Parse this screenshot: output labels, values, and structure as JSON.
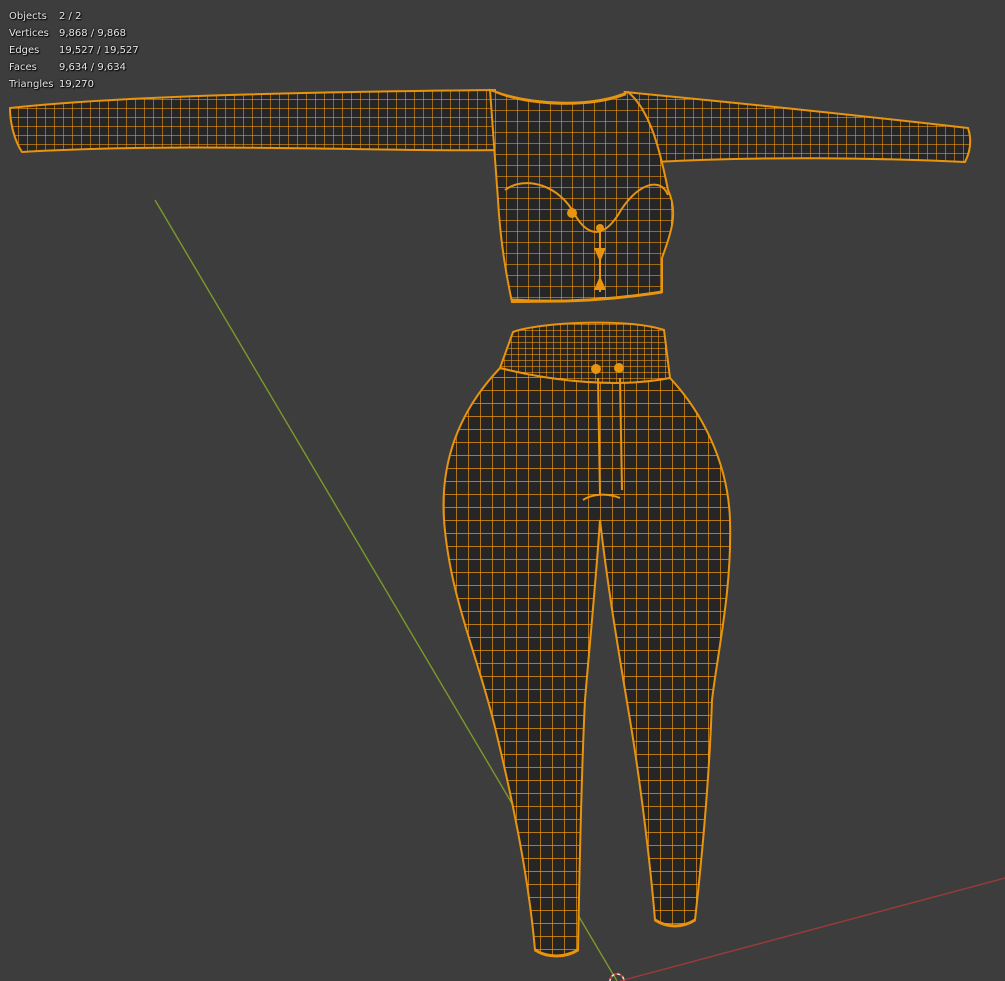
{
  "stats": [
    {
      "label": "Objects",
      "value": "2 / 2"
    },
    {
      "label": "Vertices",
      "value": "9,868 / 9,868"
    },
    {
      "label": "Edges",
      "value": "19,527 / 19,527"
    },
    {
      "label": "Faces",
      "value": "9,634 / 9,634"
    },
    {
      "label": "Triangles",
      "value": "19,270"
    }
  ],
  "colors": {
    "background": "#3d3d3d",
    "wire": "#e8940f",
    "wire_dark": "#b86f00",
    "axis_y": "#7a9a2a",
    "axis_x": "#9a3a3a"
  },
  "icons": [
    "3d-cursor-icon"
  ]
}
